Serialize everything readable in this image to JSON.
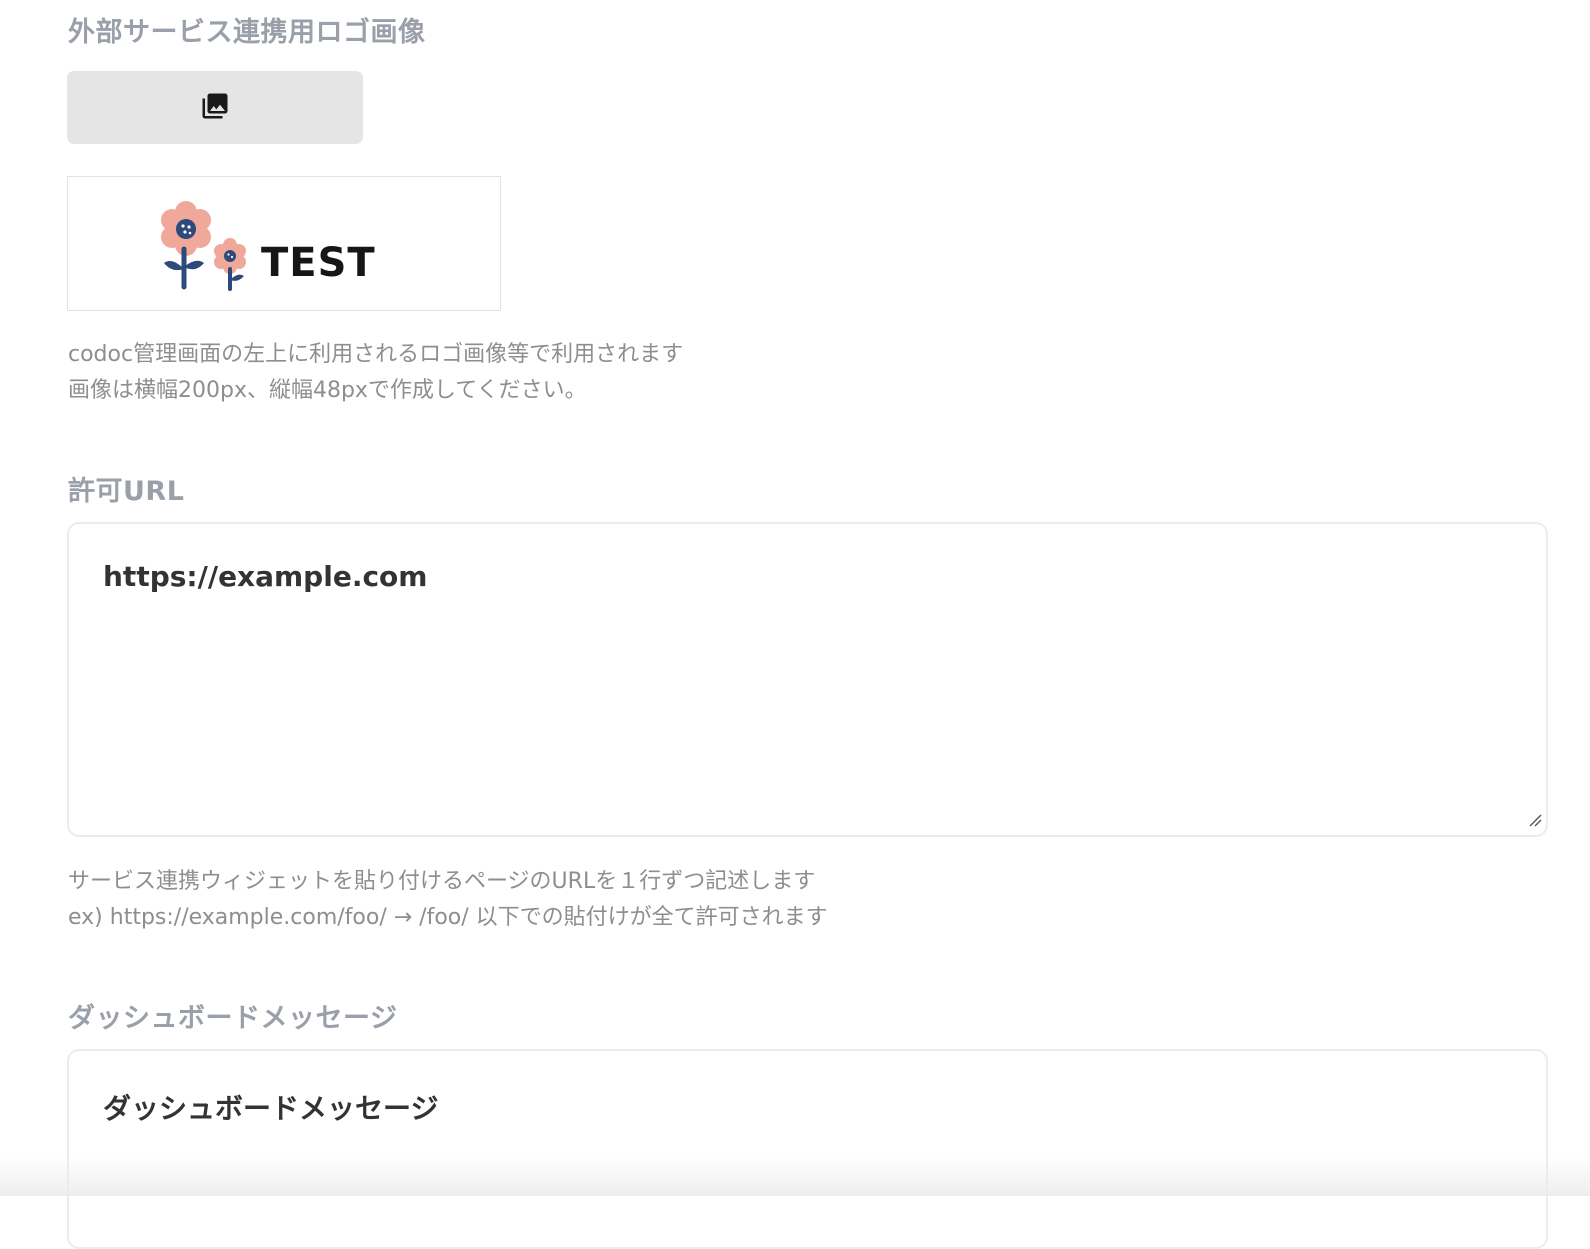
{
  "logo_section": {
    "label": "外部サービス連携用ロゴ画像",
    "upload_icon": "photo-library-icon",
    "preview_text": "TEST",
    "help_lines": [
      "codoc管理画面の左上に利用されるロゴ画像等で利用されます",
      "画像は横幅200px、縦幅48pxで作成してください。"
    ]
  },
  "allowed_url_section": {
    "label": "許可URL",
    "value": "https://example.com",
    "help_lines": [
      "サービス連携ウィジェットを貼り付けるページのURLを１行ずつ記述します",
      "ex) https://example.com/foo/ → /foo/ 以下での貼付けが全て許可されます"
    ]
  },
  "dashboard_message_section": {
    "label": "ダッシュボードメッセージ",
    "value": "ダッシュボードメッセージ"
  },
  "colors": {
    "label": "#9aa0aa",
    "help": "#8e8e8e",
    "flower_petal": "#f0a89a",
    "flower_center": "#2c4a7a",
    "stem": "#2c4a7a"
  }
}
